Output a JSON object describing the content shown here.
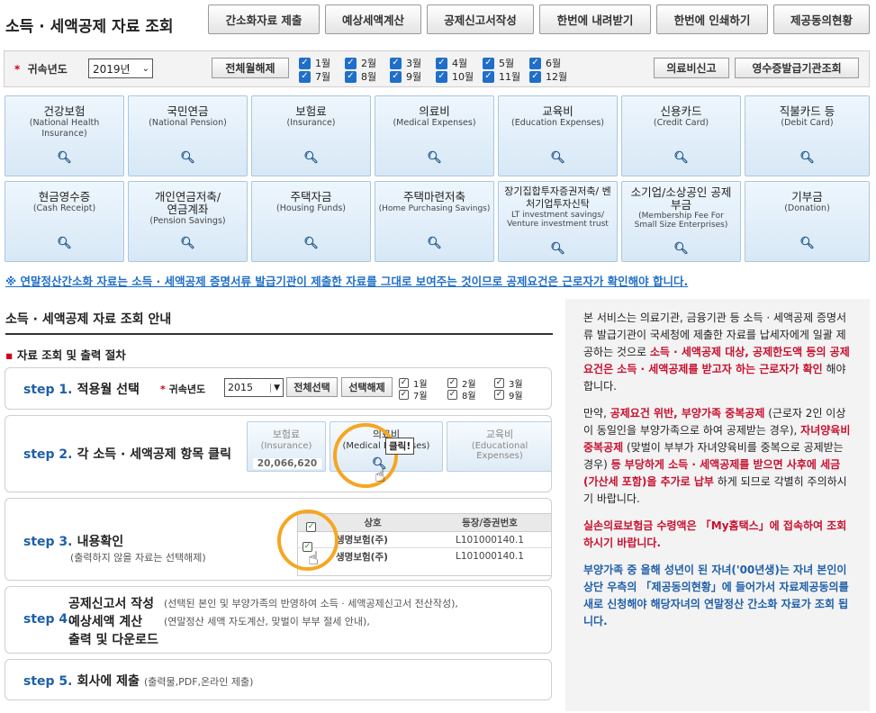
{
  "page_title": "소득 · 세액공제 자료 조회",
  "top_buttons": [
    "간소화자료 제출",
    "예상세액계산",
    "공제신고서작성",
    "한번에 내려받기",
    "한번에 인쇄하기",
    "제공동의현황"
  ],
  "filter": {
    "label": "귀속년도",
    "year_value": "2019년",
    "toggle_all_label": "전체월해제",
    "months_row1": [
      "1월",
      "2월",
      "3월",
      "4월",
      "5월",
      "6월"
    ],
    "months_row2": [
      "7월",
      "8월",
      "9월",
      "10월",
      "11월",
      "12월"
    ],
    "medical_report_label": "의료비신고",
    "receipt_lookup_label": "영수증발급기관조회"
  },
  "tiles": [
    {
      "ko": "건강보험",
      "en": "(National Health Insurance)"
    },
    {
      "ko": "국민연금",
      "en": "(National Pension)"
    },
    {
      "ko": "보험료",
      "en": "(Insurance)"
    },
    {
      "ko": "의료비",
      "en": "(Medical Expenses)"
    },
    {
      "ko": "교육비",
      "en": "(Education Expenses)"
    },
    {
      "ko": "신용카드",
      "en": "(Credit Card)"
    },
    {
      "ko": "직불카드 등",
      "en": "(Debit Card)"
    },
    {
      "ko": "현금영수증",
      "en": "(Cash Receipt)"
    },
    {
      "ko": "개인연금저축/ 연금계좌",
      "en": "(Pension Savings)"
    },
    {
      "ko": "주택자금",
      "en": "(Housing Funds)"
    },
    {
      "ko": "주택마련저축",
      "en": "(Home Purchasing Savings)"
    },
    {
      "ko": "장기집합투자증권저축/ 벤처기업투자신탁",
      "en": "LT investment savings/ Venture investment trust"
    },
    {
      "ko": "소기업/소상공인 공제부금",
      "en": "(Membership Fee For Small Size Enterprises)"
    },
    {
      "ko": "기부금",
      "en": "(Donation)"
    }
  ],
  "notice": "※ 연말정산간소화 자료는 소득 · 세액공제 증명서류 발급기관이 제출한 자료를 그대로 보여주는 것이므로 공제요건은 근로자가 확인해야 합니다.",
  "guide": {
    "title": "소득 · 세액공제 자료 조회 안내",
    "proc_title": "자료 조회 및 출력 절차",
    "step1": {
      "no": "step 1.",
      "text": "적용월 선택",
      "label": "귀속년도",
      "year": "2015",
      "select_all": "전체선택",
      "deselect": "선택해제",
      "months": [
        "1월",
        "2월",
        "3월",
        "7월",
        "8월",
        "9월"
      ]
    },
    "step2": {
      "no": "step 2.",
      "text": "각 소득 · 세액공제 항목 클릭",
      "t1_ko": "보험료",
      "t1_en": "(Insurance)",
      "t1_amount": "20,066,620",
      "t2_ko": "의료비",
      "t2_en": "(Medical Expenses)",
      "t3_ko": "교육비",
      "t3_en": "(Educational Expenses)",
      "click": "클릭!"
    },
    "step3": {
      "no": "step 3.",
      "text": "내용확인",
      "sub": "(출력하지 않을 자료는 선택해제)",
      "col1": "상호",
      "col2": "등장/증권번호",
      "rows": [
        [
          "생명보험(주)",
          "L101000140.1"
        ],
        [
          "생명보험(주)",
          "L101000140.1"
        ]
      ]
    },
    "step4": {
      "no": "step 4.",
      "l1": "공제신고서 작성",
      "l1_sub": "(선택된 본인 및 부양가족의 반영하여 소득 · 세액공제신고서 전산작성),",
      "l2": "예상세액 계산",
      "l2_sub": "(연말정산 세액 자도계산, 맞벌이 부부 절세 안내),",
      "l3": "출력 및 다운로드"
    },
    "step5": {
      "no": "step 5.",
      "text": "회사에 제출",
      "sub": "(출력물,PDF,온라인 제출)"
    }
  },
  "info": {
    "p1_a": "본 서비스는 의료기관, 금융기관 등 소득 · 세액공제 증명서류 발급기관이 국세청에 제출한 자료를 납세자에게 일괄 제공하는 것으로 ",
    "p1_b": "소득 · 세액공제 대상, 공제한도액 등의 공제요건은 소득 · 세액공제를 받고자 하는 근로자가 확인",
    "p1_c": " 해야 합니다.",
    "p2_a": "만약, ",
    "p2_b": "공제요건 위반, 부양가족 중복공제",
    "p2_c": " (근로자 2인 이상이 동일인을 부양가족으로 하여 공제받는 경우), ",
    "p2_d": "자녀양육비 중복공제",
    "p2_e": " (맞벌이 부부가 자녀양육비를 중복으로 공제받는 경우) ",
    "p2_f": "등 부당하게 소득 · 세액공제를 받으면 사후에 세금(가산세 포함)을 추가로 납부",
    "p2_g": " 하게 되므로 각별히 주의하시기 바랍니다.",
    "p3": "실손의료보험금 수령액은 「My홈택스」에 접속하여 조회하시기 바랍니다.",
    "p4": "부양가족 중 올해 성년이 된 자녀('00년생)는 자녀 본인이 상단 우측의 「제공동의현황」에 들어가서 자료제공동의를 새로 신청해야 해당자녀의 연말정산 간소화 자료가 조회 됩니다."
  },
  "colors": {
    "accent_blue": "#1f5fa8",
    "checkbox_blue": "#1f6fc9",
    "warning_red": "#c8102e",
    "highlight_orange": "#f5a623"
  },
  "icons": {
    "tile_icon": "search-icon",
    "checkbox": "checkbox-checked-icon",
    "pointer": "hand-pointer-icon"
  }
}
